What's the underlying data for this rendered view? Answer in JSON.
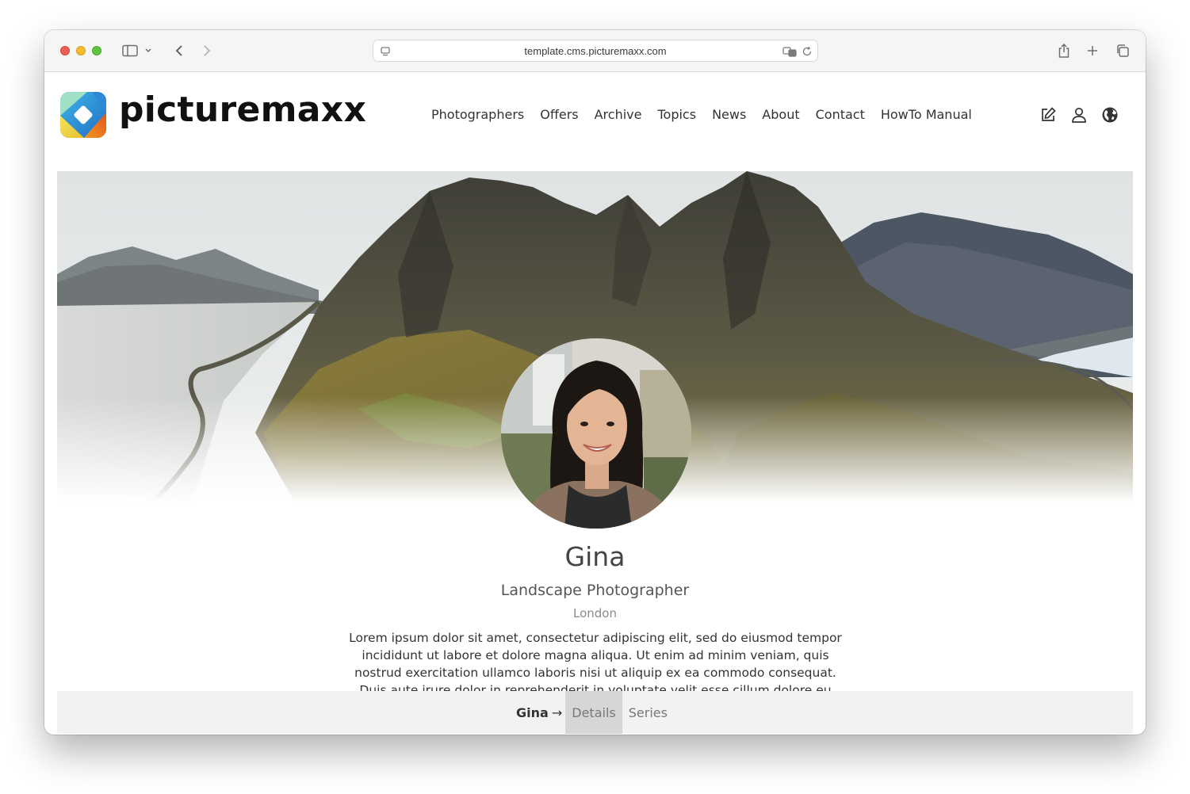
{
  "browser": {
    "url": "template.cms.picturemaxx.com"
  },
  "site": {
    "brand": "picturemaxx",
    "nav": [
      "Photographers",
      "Offers",
      "Archive",
      "Topics",
      "News",
      "About",
      "Contact",
      "HowTo Manual"
    ],
    "header_icons": [
      "edit-icon",
      "user-icon",
      "globe-icon"
    ]
  },
  "profile": {
    "name": "Gina",
    "title": "Landscape Photographer",
    "location": "London",
    "bio": "Lorem ipsum dolor sit amet, consectetur adipiscing elit, sed do eiusmod tempor incididunt ut labore et dolore magna aliqua. Ut enim ad minim veniam, quis nostrud exercitation ullamco laboris nisi ut aliquip ex ea commodo consequat. Duis aute irure dolor in reprehenderit in voluptate velit esse cillum dolore eu fugiat nulla pariatur."
  },
  "subnav": {
    "crumb": "Gina",
    "arrow": "→",
    "tabs": [
      "Details",
      "Series"
    ],
    "active_tab": "Details"
  },
  "colors": {
    "subnav_bg": "#f2f2f2",
    "active_tab_bg": "#d6d6d6",
    "text": "#333333"
  }
}
